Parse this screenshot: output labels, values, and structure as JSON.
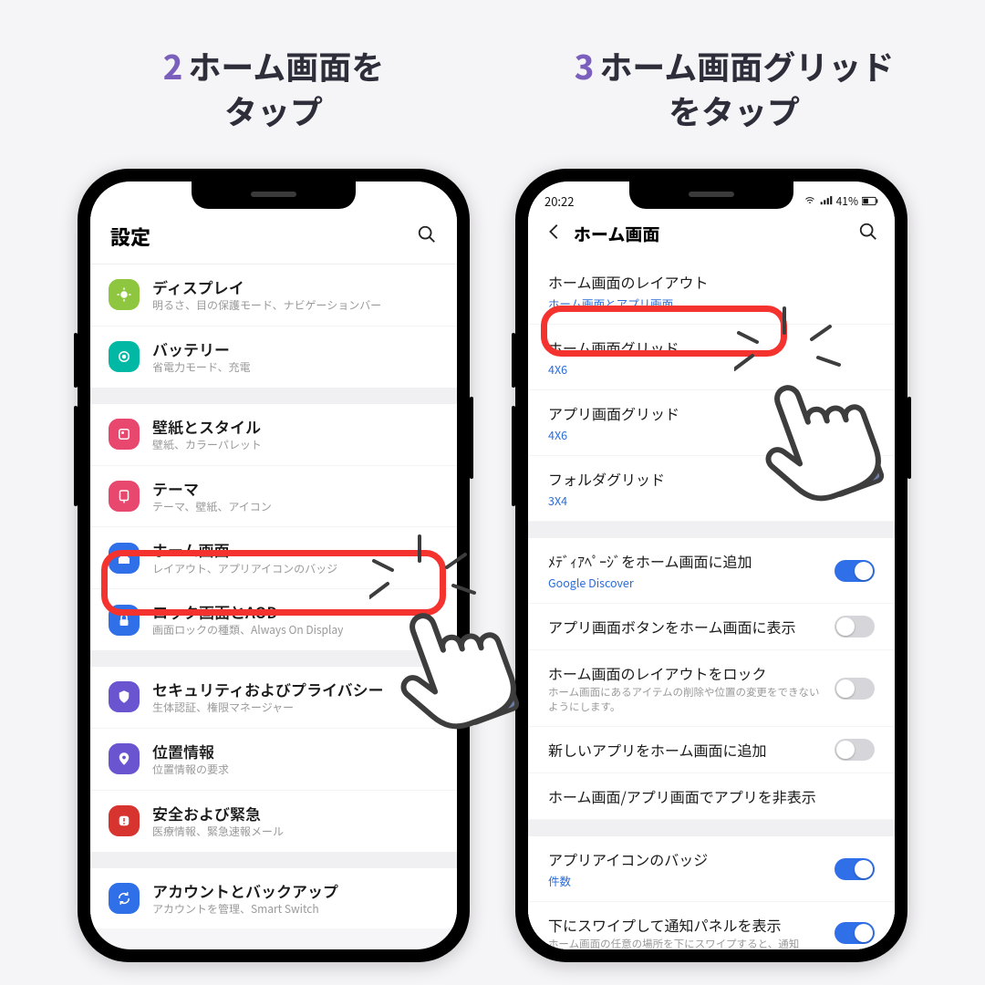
{
  "headings": {
    "step2_num": "2",
    "step2_a": "ホーム画面を",
    "step2_b": "タップ",
    "step3_num": "3",
    "step3_a": "ホーム画面グリッド",
    "step3_b": "をタップ"
  },
  "screen1": {
    "title": "設定",
    "groups": [
      [
        {
          "icon": "display",
          "color": "#8ec63f",
          "title": "ディスプレイ",
          "sub": "明るさ、目の保護モード、ナビゲーションバー"
        },
        {
          "icon": "battery",
          "color": "#00b8a4",
          "title": "バッテリー",
          "sub": "省電力モード、充電"
        }
      ],
      [
        {
          "icon": "wallpaper",
          "color": "#e8476e",
          "title": "壁紙とスタイル",
          "sub": "壁紙、カラーパレット"
        },
        {
          "icon": "theme",
          "color": "#e8476e",
          "title": "テーマ",
          "sub": "テーマ、壁紙、アイコン"
        },
        {
          "icon": "home",
          "color": "#2f6fe7",
          "title": "ホーム画面",
          "sub": "レイアウト、アプリアイコンのバッジ"
        },
        {
          "icon": "lock",
          "color": "#2f6fe7",
          "title": "ロック画面とAOD",
          "sub": "画面ロックの種類、Always On Display"
        }
      ],
      [
        {
          "icon": "shield",
          "color": "#6a54d0",
          "title": "セキュリティおよびプライバシー",
          "sub": "生体認証、権限マネージャー"
        },
        {
          "icon": "pin",
          "color": "#6a54d0",
          "title": "位置情報",
          "sub": "位置情報の要求"
        },
        {
          "icon": "alert",
          "color": "#d7342f",
          "title": "安全および緊急",
          "sub": "医療情報、緊急速報メール"
        }
      ],
      [
        {
          "icon": "sync",
          "color": "#2f6fe7",
          "title": "アカウントとバックアップ",
          "sub": "アカウントを管理、Smart Switch"
        }
      ]
    ]
  },
  "screen2": {
    "status_time": "20:22",
    "status_batt": "41%",
    "title": "ホーム画面",
    "sec1": [
      {
        "title": "ホーム画面のレイアウト",
        "value": "ホーム画面とアプリ画面"
      },
      {
        "title": "ホーム画面グリッド",
        "value": "4X6"
      },
      {
        "title": "アプリ画面グリッド",
        "value": "4X6"
      },
      {
        "title": "フォルダグリッド",
        "value": "3X4"
      }
    ],
    "sec2": [
      {
        "title": "ﾒﾃﾞｨｱﾍﾟｰｼﾞをホーム画面に追加",
        "value": "Google Discover",
        "toggle": "on"
      },
      {
        "title": "アプリ画面ボタンをホーム画面に表示",
        "toggle": "off"
      },
      {
        "title": "ホーム画面のレイアウトをロック",
        "sub": "ホーム画面にあるアイテムの削除や位置の変更をできないようにします。",
        "toggle": "off"
      },
      {
        "title": "新しいアプリをホーム画面に追加",
        "toggle": "off"
      },
      {
        "title": "ホーム画面/アプリ画面でアプリを非表示"
      }
    ],
    "sec3": [
      {
        "title": "アプリアイコンのバッジ",
        "value": "件数",
        "toggle": "on"
      },
      {
        "title": "下にスワイプして通知パネルを表示",
        "sub": "ホーム画面の任意の場所を下にスワイプすると、通知",
        "toggle": "on"
      }
    ]
  }
}
